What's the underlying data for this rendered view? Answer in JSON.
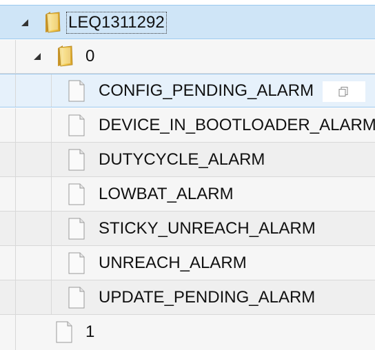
{
  "tree": {
    "root": {
      "label": "LEQ1311292",
      "icon": "folder-icon",
      "expanded": true
    },
    "channel": {
      "label": "0",
      "icon": "folder-icon",
      "expanded": true
    },
    "alarms": [
      {
        "label": "CONFIG_PENDING_ALARM",
        "icon": "file-icon"
      },
      {
        "label": "DEVICE_IN_BOOTLOADER_ALARM",
        "icon": "file-icon"
      },
      {
        "label": "DUTYCYCLE_ALARM",
        "icon": "file-icon"
      },
      {
        "label": "LOWBAT_ALARM",
        "icon": "file-icon"
      },
      {
        "label": "STICKY_UNREACH_ALARM",
        "icon": "file-icon"
      },
      {
        "label": "UNREACH_ALARM",
        "icon": "file-icon"
      },
      {
        "label": "UPDATE_PENDING_ALARM",
        "icon": "file-icon"
      }
    ],
    "sibling": {
      "label": "1",
      "icon": "file-icon"
    },
    "copy_action": {
      "icon": "copy-icon"
    }
  },
  "colors": {
    "selected_row": "#cfe5f7",
    "hover_row": "#e6f1fb",
    "row_bg": "#efefef",
    "row_alt_bg": "#f6f6f6",
    "grid_line": "#d8d8d8",
    "folder_yellow": "#f2c94c"
  }
}
